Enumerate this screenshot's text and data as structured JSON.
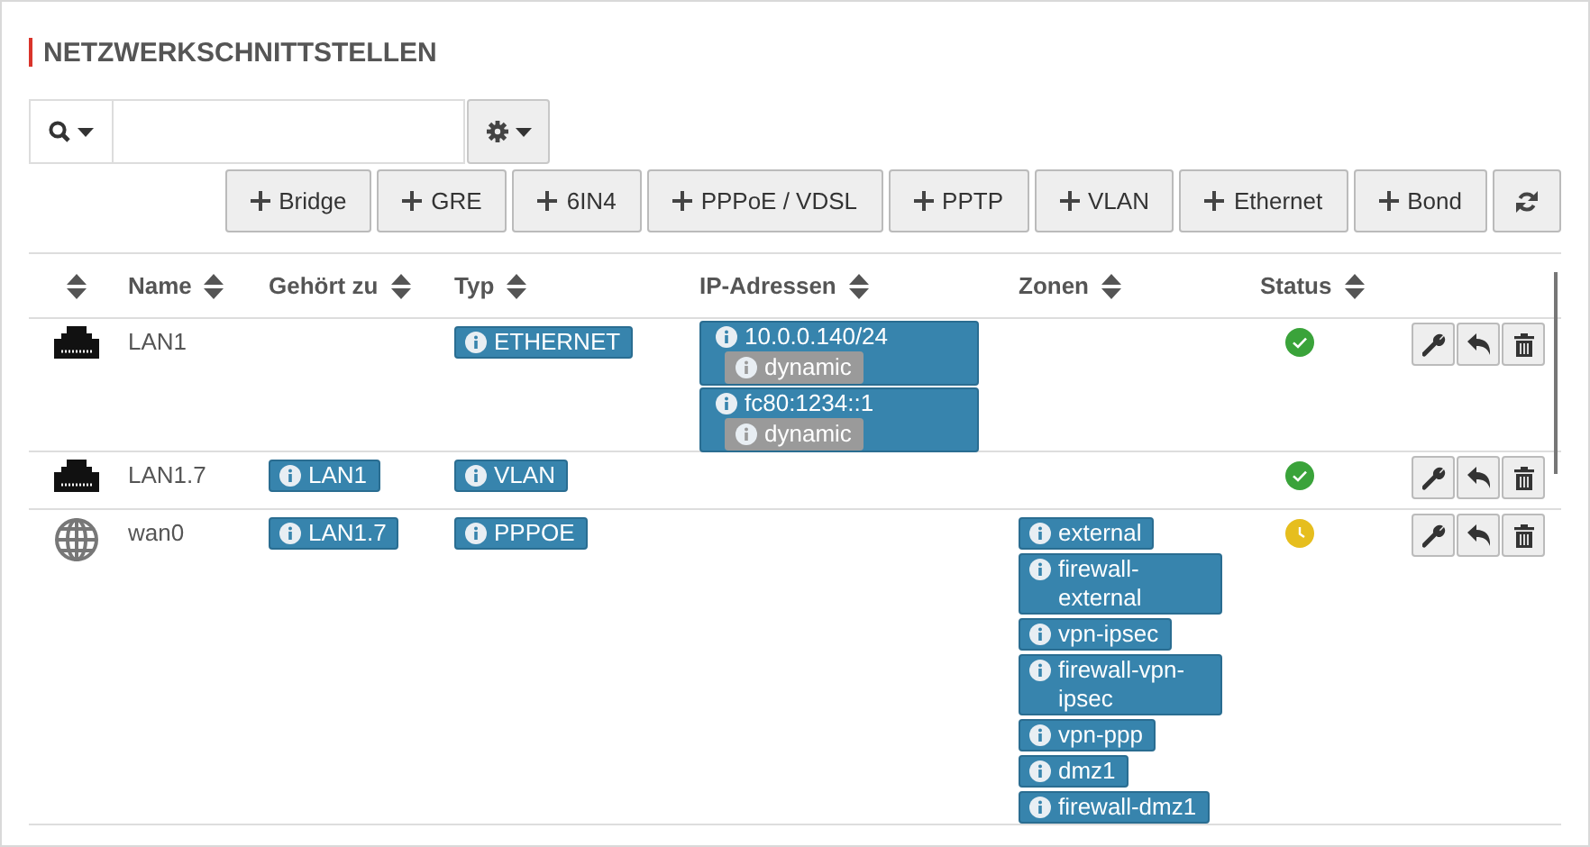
{
  "title": "NETZWERKSCHNITTSTELLEN",
  "add_buttons": [
    "Bridge",
    "GRE",
    "6IN4",
    "PPPoE / VDSL",
    "PPTP",
    "VLAN",
    "Ethernet",
    "Bond"
  ],
  "columns": [
    "Name",
    "Gehört zu",
    "Typ",
    "IP-Adressen",
    "Zonen",
    "Status"
  ],
  "rows": [
    {
      "kind": "ethernet",
      "name": "LAN1",
      "type": "ETHERNET",
      "addresses": [
        {
          "address": "10.0.0.140/24",
          "mode": "dynamic"
        },
        {
          "address": "fc80:1234::1",
          "mode": "dynamic"
        }
      ],
      "pending": false
    },
    {
      "kind": "ethernet",
      "name": "LAN1.7",
      "parent": "LAN1",
      "type": "VLAN",
      "pending": false
    },
    {
      "kind": "globe",
      "name": "wan0",
      "parent": "LAN1.7",
      "type": "PPPOE",
      "zones": [
        "external",
        "firewall-external",
        "vpn-ipsec",
        "firewall-vpn-ipsec",
        "vpn-ppp",
        "dmz1",
        "firewall-dmz1"
      ],
      "pending": true
    }
  ]
}
